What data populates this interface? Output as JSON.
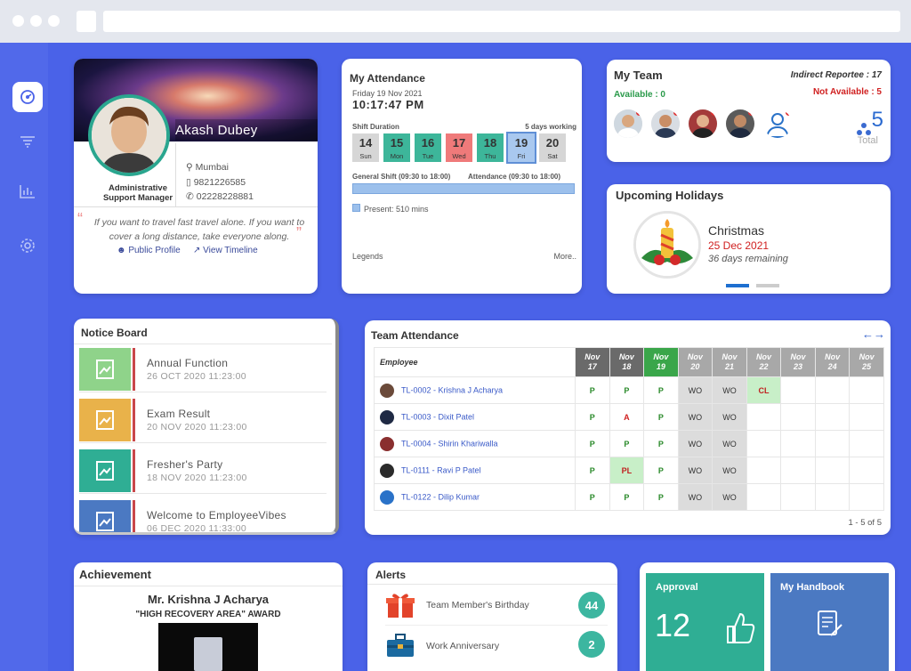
{
  "profile": {
    "name": "Akash Dubey",
    "role_line1": "Administrative",
    "role_line2": "Support Manager",
    "city": "Mumbai",
    "mobile": "9821226585",
    "phone": "02228228881",
    "quote": "If you want to travel fast travel alone. If you want to cover a long distance, take everyone along.",
    "public_profile": "Public Profile",
    "view_timeline": "View Timeline"
  },
  "attendance": {
    "title": "My Attendance",
    "date": "Friday 19 Nov 2021",
    "time": "10:17:47 PM",
    "shift_label": "Shift Duration",
    "working_label": "5 days working",
    "days": [
      {
        "num": "14",
        "day": "Sun",
        "color": "#d6d6d6"
      },
      {
        "num": "15",
        "day": "Mon",
        "color": "#3db69a"
      },
      {
        "num": "16",
        "day": "Tue",
        "color": "#3db69a"
      },
      {
        "num": "17",
        "day": "Wed",
        "color": "#ef7a7a"
      },
      {
        "num": "18",
        "day": "Thu",
        "color": "#3db69a"
      },
      {
        "num": "19",
        "day": "Fri",
        "color": "#a9c8ef"
      },
      {
        "num": "20",
        "day": "Sat",
        "color": "#d6d6d6"
      }
    ],
    "general_shift": "General Shift (09:30 to 18:00)",
    "attendance_range": "Attendance (09:30 to 18:00)",
    "present": "Present: 510 mins",
    "legends": "Legends",
    "more": "More.."
  },
  "team": {
    "title": "My Team",
    "indirect": "Indirect Reportee : 17",
    "available": "Available : 0",
    "not_available": "Not Available : 5",
    "total_num": "5",
    "total_label": "Total"
  },
  "holidays": {
    "title": "Upcoming Holidays",
    "name": "Christmas",
    "date": "25 Dec 2021",
    "remaining": "36 days remaining"
  },
  "notice": {
    "title": "Notice Board",
    "items": [
      {
        "title": "Annual Function",
        "date": "26 OCT 2020 11:23:00",
        "color": "#8fd38a"
      },
      {
        "title": "Exam Result",
        "date": "20 NOV 2020 11:23:00",
        "color": "#e9b24a"
      },
      {
        "title": "Fresher's Party",
        "date": "18 NOV 2020 11:23:00",
        "color": "#2fae94"
      },
      {
        "title": "Welcome to EmployeeVibes",
        "date": "06 DEC 2020 11:33:00",
        "color": "#4b79c2"
      }
    ]
  },
  "team_attendance": {
    "title": "Team Attendance",
    "employee_header": "Employee",
    "dates": [
      {
        "m": "Nov",
        "d": "17"
      },
      {
        "m": "Nov",
        "d": "18"
      },
      {
        "m": "Nov",
        "d": "19"
      },
      {
        "m": "Nov",
        "d": "20"
      },
      {
        "m": "Nov",
        "d": "21"
      },
      {
        "m": "Nov",
        "d": "22"
      },
      {
        "m": "Nov",
        "d": "23"
      },
      {
        "m": "Nov",
        "d": "24"
      },
      {
        "m": "Nov",
        "d": "25"
      }
    ],
    "rows": [
      {
        "name": "TL-0002 - Krishna J Acharya",
        "cells": [
          "P",
          "P",
          "P",
          "WO",
          "WO",
          "CL",
          "",
          "",
          ""
        ]
      },
      {
        "name": "TL-0003 - Dixit Patel",
        "cells": [
          "P",
          "A",
          "P",
          "WO",
          "WO",
          "",
          "",
          "",
          ""
        ]
      },
      {
        "name": "TL-0004 - Shirin Khariwalla",
        "cells": [
          "P",
          "P",
          "P",
          "WO",
          "WO",
          "",
          "",
          "",
          ""
        ]
      },
      {
        "name": "TL-0111 - Ravi P Patel",
        "cells": [
          "P",
          "PL",
          "P",
          "WO",
          "WO",
          "",
          "",
          "",
          ""
        ]
      },
      {
        "name": "TL-0122 - Dilip Kumar",
        "cells": [
          "P",
          "P",
          "P",
          "WO",
          "WO",
          "",
          "",
          "",
          ""
        ]
      }
    ],
    "pagination": "1 - 5 of 5"
  },
  "achievement": {
    "title": "Achievement",
    "person": "Mr. Krishna J Acharya",
    "award": "\"HIGH RECOVERY AREA\" AWARD"
  },
  "alerts": {
    "title": "Alerts",
    "items": [
      {
        "label": "Team Member's Birthday",
        "count": "44"
      },
      {
        "label": "Work Anniversary",
        "count": "2"
      }
    ]
  },
  "approval": {
    "title": "Approval",
    "count": "12"
  },
  "handbook": {
    "title": "My Handbook"
  }
}
